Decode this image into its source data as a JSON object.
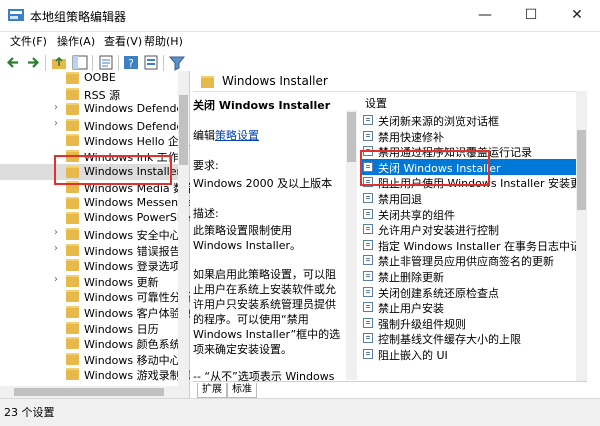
{
  "window": {
    "title": "本地组策略编辑器",
    "minimize": "—",
    "maximize": "☐",
    "close": "✕"
  },
  "menu": [
    "文件(F)",
    "操作(A)",
    "查看(V)",
    "帮助(H)"
  ],
  "tree": {
    "items": [
      {
        "label": "OOBE",
        "expandable": false
      },
      {
        "label": "RSS 源",
        "expandable": false
      },
      {
        "label": "Windows Defender S",
        "expandable": true
      },
      {
        "label": "Windows Defender 日",
        "expandable": true
      },
      {
        "label": "Windows Hello 企业",
        "expandable": false
      },
      {
        "label": "Windows Ink 工作区",
        "expandable": false
      },
      {
        "label": "Windows Installer",
        "expandable": false,
        "selected": true
      },
      {
        "label": "Windows Media 数字",
        "expandable": false
      },
      {
        "label": "Windows Messenger",
        "expandable": false
      },
      {
        "label": "Windows PowerShell",
        "expandable": false
      },
      {
        "label": "Windows 安全中心",
        "expandable": true
      },
      {
        "label": "Windows 错误报告",
        "expandable": true
      },
      {
        "label": "Windows 登录选项",
        "expandable": false
      },
      {
        "label": "Windows 更新",
        "expandable": true
      },
      {
        "label": "Windows 可靠性分析",
        "expandable": false
      },
      {
        "label": "Windows 客户体验改",
        "expandable": false
      },
      {
        "label": "Windows 日历",
        "expandable": false
      },
      {
        "label": "Windows 颜色系统",
        "expandable": false
      },
      {
        "label": "Windows 移动中心",
        "expandable": false
      },
      {
        "label": "Windows 游戏录制和",
        "expandable": false
      }
    ]
  },
  "header": {
    "title": "Windows Installer"
  },
  "description": {
    "policy_title": "关闭 Windows Installer",
    "edit_prefix": "编辑",
    "edit_link": "策略设置",
    "requirement_label": "要求:",
    "requirement": "Windows 2000 及以上版本",
    "desc_label": "描述:",
    "desc_text": "此策略设置限制使用 Windows Installer。",
    "para1": "如果启用此策略设置，可以阻止用户在系统上安装软件或允许用户只安装系统管理员提供的程序。可以使用“禁用 Windows Installer”框中的选项来确定安装设置。",
    "para2": "-- “从不”选项表示 Windows Installer 处于完全启用状态，用户可以安装和升级软件。当没有配置该策略时，这是 Windows 2000"
  },
  "settings": {
    "header": "设置",
    "items": [
      "关闭新来源的浏览对话框",
      "禁用快速修补",
      "禁用通过程序知识覆盖运行记录",
      "关闭 Windows Installer",
      "阻止用户使用 Windows Installer 安装更新和升",
      "禁用回退",
      "关闭共享的组件",
      "允许用户对安装进行控制",
      "指定 Windows Installer 在事务日志中记录的事",
      "禁止非管理员应用供应商签名的更新",
      "禁止删除更新",
      "关闭创建系统还原检查点",
      "禁止用户安装",
      "强制升级组件规则",
      "控制基线文件缓存大小的上限",
      "阻止嵌入的 UI"
    ],
    "selected_index": 3
  },
  "tabs": [
    "扩展",
    "标准"
  ],
  "status": {
    "text": "23 个设置"
  }
}
